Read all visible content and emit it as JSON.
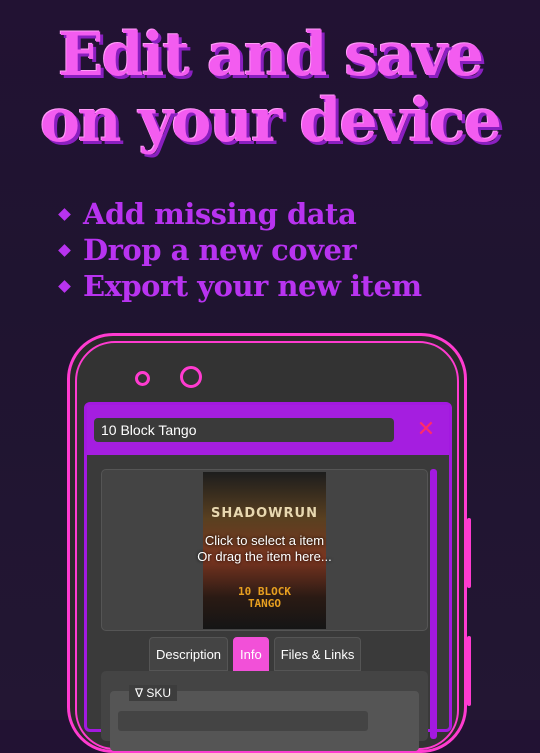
{
  "headline": {
    "line1": "Edit and save",
    "line2": "on your device"
  },
  "bullets": [
    {
      "label": "Add missing data"
    },
    {
      "label": "Drop a new cover"
    },
    {
      "label": "Export your new item"
    }
  ],
  "dialog": {
    "title_value": "10 Block Tango",
    "close_label": "✕",
    "dropzone": {
      "line1": "Click to select a item",
      "line2": "Or drag the item here...",
      "cover_title_top": "SHADOWRUN",
      "cover_title_bottom_1": "10 BLOCK",
      "cover_title_bottom_2": "TANGO"
    },
    "tabs": [
      {
        "label": "Description",
        "active": false
      },
      {
        "label": "Info",
        "active": true
      },
      {
        "label": "Files & Links",
        "active": false
      }
    ],
    "sku_legend": "∇ SKU"
  },
  "colors": {
    "accent": "#a51ee0",
    "pink": "#ff3bd0",
    "active_tab": "#f250d8",
    "headline": "#f35cf0",
    "bullet_text": "#b833f0",
    "close": "#ff2b6a"
  }
}
